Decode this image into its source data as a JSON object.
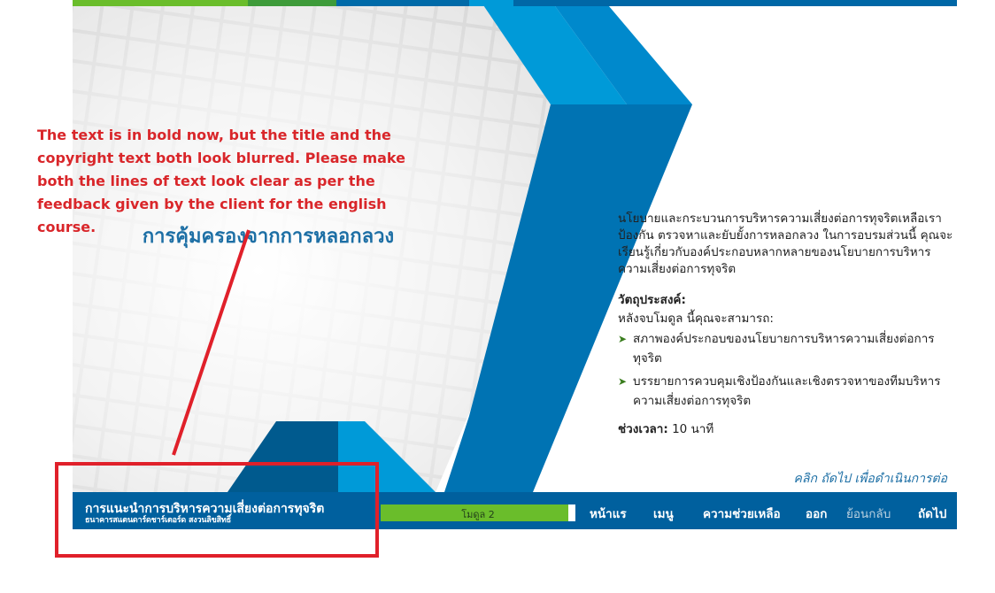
{
  "annotation": {
    "text": "The text is in bold now, but the title and the copyright text both look blurred. Please make both the lines of text look clear as per the feedback given by the client for the english course."
  },
  "course_title": "การคุ้มครองจากการหลอกลวง",
  "intro": "นโยบายและกระบวนการบริหารความเสี่ยงต่อการทุจริตเหลือเราป้องกัน ตรวจหาและยับยั้งการหลอกลวง ในการอบรมส่วนนี้ คุณจะเรียนรู้เกี่ยวกับองค์ประกอบหลากหลายของนโยบายการบริหารความเสี่ยงต่อการทุจริต",
  "objectives": {
    "heading": "วัตถุประสงค์:",
    "lead": "หลังจบโมดูล นี้คุณจะสามารถ:",
    "items": [
      "สภาพองค์ประกอบของนโยบายการบริหารความเสี่ยงต่อการทุจริต",
      "บรรยายการควบคุมเชิงป้องกันและเชิงตรวจหาของทีมบริหารความเสี่ยงต่อการทุจริต"
    ]
  },
  "duration": {
    "label": "ช่วงเวลา:",
    "value": "10 นาที"
  },
  "click_next": "คลิก ถัดไป เพื่อดำเนินการต่อ",
  "footer": {
    "title": "การแนะนำการบริหารความเสี่ยงต่อการทุจริต",
    "copyright": "ธนาคารสแตนดาร์ดชาร์เตอร์ด สงวนลิขสิทธิ์",
    "module": "โมดูล 2",
    "nav": {
      "home": "หน้าแร",
      "menu": "เมนู",
      "help": "ความช่วยเหลือ",
      "exit": "ออก",
      "back": "ย้อนกลับ",
      "next": "ถัดไป"
    }
  },
  "colors": {
    "nav_blue": "#00609e",
    "ribbon_light": "#009ad8",
    "ribbon_dark": "#0073b3",
    "module_green": "#6abd2b",
    "annotation_red": "#d9262a"
  }
}
